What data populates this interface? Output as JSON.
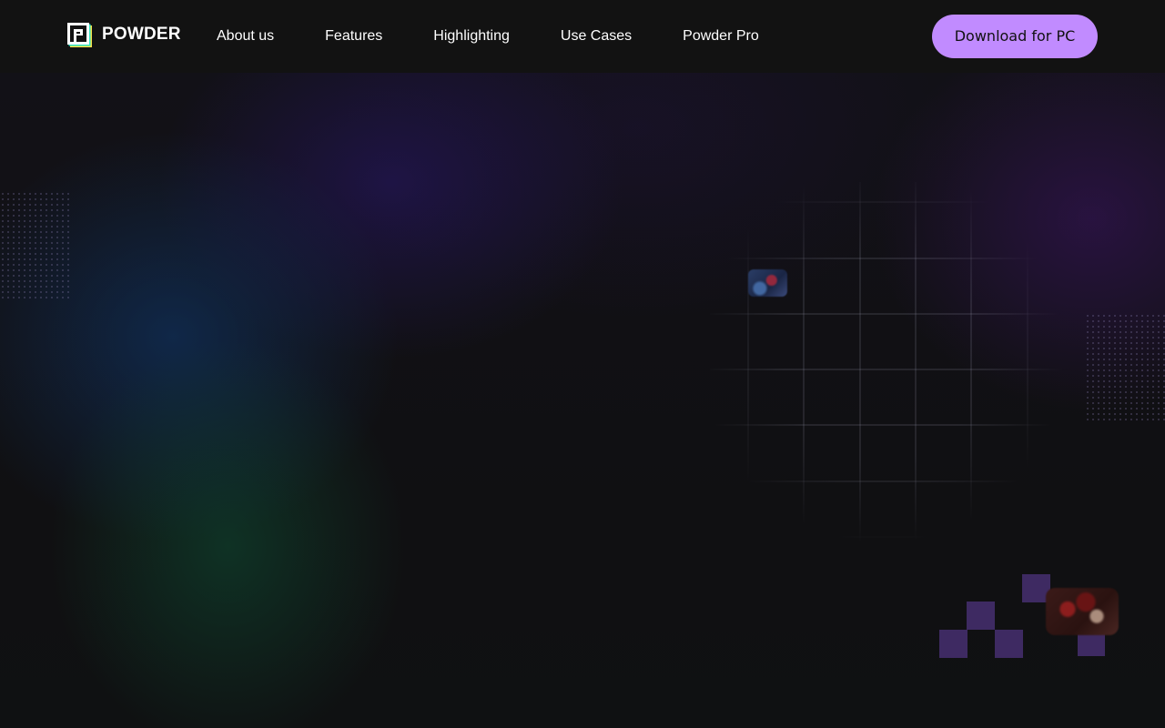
{
  "brand": {
    "name": "POWDER",
    "logo_icon": "powder-logo-icon",
    "logo_colors": [
      "#ffffff",
      "#2ee6c5",
      "#f6e04a"
    ]
  },
  "nav": {
    "links": [
      {
        "label": "About us"
      },
      {
        "label": "Features"
      },
      {
        "label": "Highlighting"
      },
      {
        "label": "Use Cases"
      },
      {
        "label": "Powder Pro"
      }
    ],
    "cta_label": "Download for PC"
  },
  "colors": {
    "nav_background": "#121212",
    "cta_background": "#c18bff",
    "page_background": "#0f1011",
    "pixel_accent": "#3e2a62"
  }
}
